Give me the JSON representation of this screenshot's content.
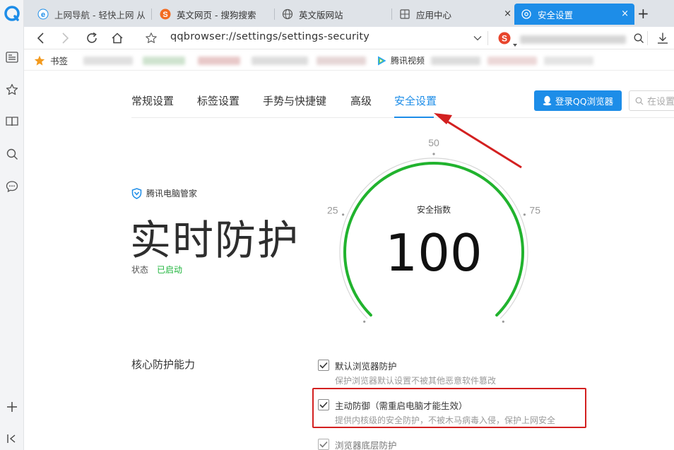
{
  "tabs": [
    {
      "title": "上网导航 - 轻快上网 从",
      "icon": "ie-icon"
    },
    {
      "title": "英文网页 - 搜狗搜索",
      "icon": "sogou-icon"
    },
    {
      "title": "英文版网站",
      "icon": "globe-icon"
    },
    {
      "title": "应用中心",
      "icon": "app-center-icon"
    },
    {
      "title": "安全设置",
      "icon": "settings-gear-icon",
      "active": true
    }
  ],
  "tab_close": "×",
  "new_tab": "+",
  "address": {
    "url": "qqbrowser://settings/settings-security"
  },
  "bookmarks": {
    "label": "书签",
    "video": "腾讯视频"
  },
  "settings": {
    "tabs": [
      "常规设置",
      "标签设置",
      "手势与快捷键",
      "高级",
      "安全设置"
    ],
    "active_tab": "安全设置",
    "login_button": "登录QQ浏览器",
    "search_placeholder": "在设置"
  },
  "protection": {
    "brand": "腾讯电脑管家",
    "title": "实时防护",
    "status_label": "状态",
    "status_value": "已启动"
  },
  "gauge": {
    "label": "安全指数",
    "value": 100,
    "value_text": "100",
    "min": 0,
    "max": 100,
    "ticks": [
      "0",
      "25",
      "50",
      "75",
      "100"
    ],
    "color": "#21b32e"
  },
  "core": {
    "title": "核心防护能力",
    "options": [
      {
        "label": "默认浏览器防护",
        "desc": "保护浏览器默认设置不被其他恶意软件篡改",
        "checked": true
      },
      {
        "label": "主动防御（需重启电脑才能生效）",
        "desc": "提供内核级的安全防护，不被木马病毒入侵，保护上网安全",
        "checked": true
      },
      {
        "label": "浏览器底层防护",
        "desc": "",
        "checked": true
      }
    ]
  },
  "colors": {
    "accent": "#1d8de8",
    "annotation": "#d32020",
    "status_on": "#1fb53c"
  }
}
